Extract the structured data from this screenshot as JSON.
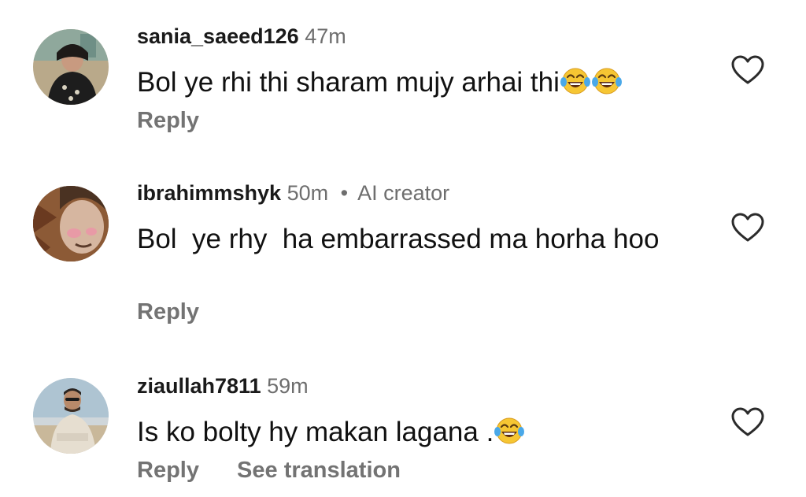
{
  "comments": [
    {
      "username": "sania_saeed126",
      "time": "47m",
      "text": "Bol ye rhi thi sharam mujy arhai thi",
      "emoji_count": 2,
      "actions": {
        "reply": "Reply"
      },
      "icons": {
        "like": "heart-outline-icon",
        "emoji": "face-with-tears-of-joy-icon"
      }
    },
    {
      "username": "ibrahimmshyk",
      "time": "50m",
      "meta": "AI creator",
      "text": "Bol  ye rhy  ha embarrassed ma horha hoo",
      "actions": {
        "reply": "Reply"
      },
      "icons": {
        "like": "heart-outline-icon"
      }
    },
    {
      "username": "ziaullah7811",
      "time": "59m",
      "text": "Is ko bolty hy makan lagana .",
      "emoji_count": 1,
      "actions": {
        "reply": "Reply",
        "translate": "See translation"
      },
      "icons": {
        "like": "heart-outline-icon",
        "emoji": "face-with-tears-of-joy-icon"
      }
    }
  ],
  "colors": {
    "text": "#111111",
    "secondary": "#6e6e6e",
    "action": "#737373",
    "background": "#ffffff"
  }
}
